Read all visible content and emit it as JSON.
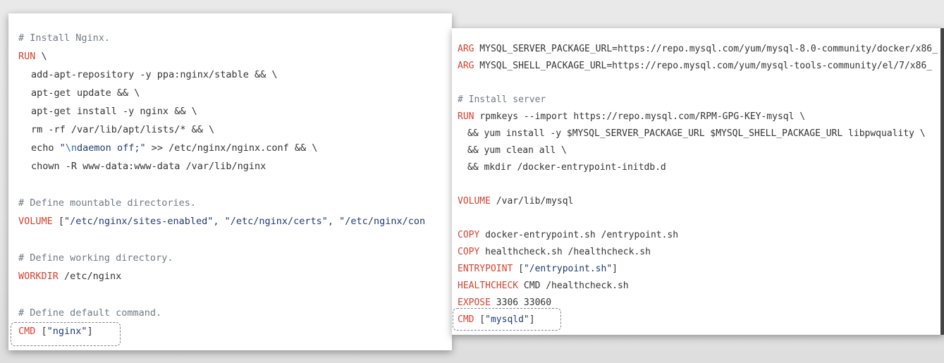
{
  "left_panel": {
    "lines": [
      {
        "c": "# Install Nginx."
      },
      {
        "k": "RUN",
        "t": " \\"
      },
      {
        "t": "add-apt-repository -y ppa:nginx/stable && \\"
      },
      {
        "t": "apt-get update && \\"
      },
      {
        "t": "apt-get install -y nginx && \\"
      },
      {
        "t": "rm -rf /var/lib/apt/lists/* && \\"
      },
      {
        "t": "echo ",
        "s1": "\"",
        "e": "\\n",
        "s2": "daemon off;\"",
        "t2": " >> /etc/nginx/nginx.conf && \\"
      },
      {
        "t": "chown -R www-data:www-data /var/lib/nginx"
      },
      {
        "c": "# Define mountable directories."
      },
      {
        "k": "VOLUME",
        "t": " [",
        "s": "\"/etc/nginx/sites-enabled\", \"/etc/nginx/certs\", \"/etc/nginx/con"
      },
      {
        "c": "# Define working directory."
      },
      {
        "k": "WORKDIR",
        "t": " /etc/nginx"
      },
      {
        "c": "# Define default command."
      },
      {
        "k": "CMD",
        "t": " [",
        "s": "\"nginx\"",
        "t2": "]"
      }
    ]
  },
  "right_panel": {
    "lines": [
      {
        "k": "ARG",
        "t": " MYSQL_SERVER_PACKAGE_URL=https://repo.mysql.com/yum/mysql-8.0-community/docker/x86_"
      },
      {
        "k": "ARG",
        "t": " MYSQL_SHELL_PACKAGE_URL=https://repo.mysql.com/yum/mysql-tools-community/el/7/x86_"
      },
      {
        "c": "# Install server"
      },
      {
        "k": "RUN",
        "t": " rpmkeys --import https://repo.mysql.com/RPM-GPG-KEY-mysql \\"
      },
      {
        "t": "&& yum install -y $MYSQL_SERVER_PACKAGE_URL $MYSQL_SHELL_PACKAGE_URL libpwquality \\"
      },
      {
        "t": "&& yum clean all \\"
      },
      {
        "t": "&& mkdir /docker-entrypoint-initdb.d"
      },
      {
        "k": "VOLUME",
        "t": " /var/lib/mysql"
      },
      {
        "k": "COPY",
        "t": " docker-entrypoint.sh /entrypoint.sh"
      },
      {
        "k": "COPY",
        "t": " healthcheck.sh /healthcheck.sh"
      },
      {
        "k": "ENTRYPOINT",
        "t": " [",
        "s": "\"/entrypoint.sh\"",
        "t2": "]"
      },
      {
        "k": "HEALTHCHECK",
        "t": " CMD /healthcheck.sh"
      },
      {
        "k": "EXPOSE",
        "t": " 3306 33060"
      },
      {
        "k": "CMD",
        "t": " [",
        "s": "\"mysqld\"",
        "t2": "]"
      }
    ]
  },
  "colors": {
    "keyword": "#d7412f",
    "comment": "#707a84",
    "string": "#1f3a73",
    "text": "#333333"
  }
}
